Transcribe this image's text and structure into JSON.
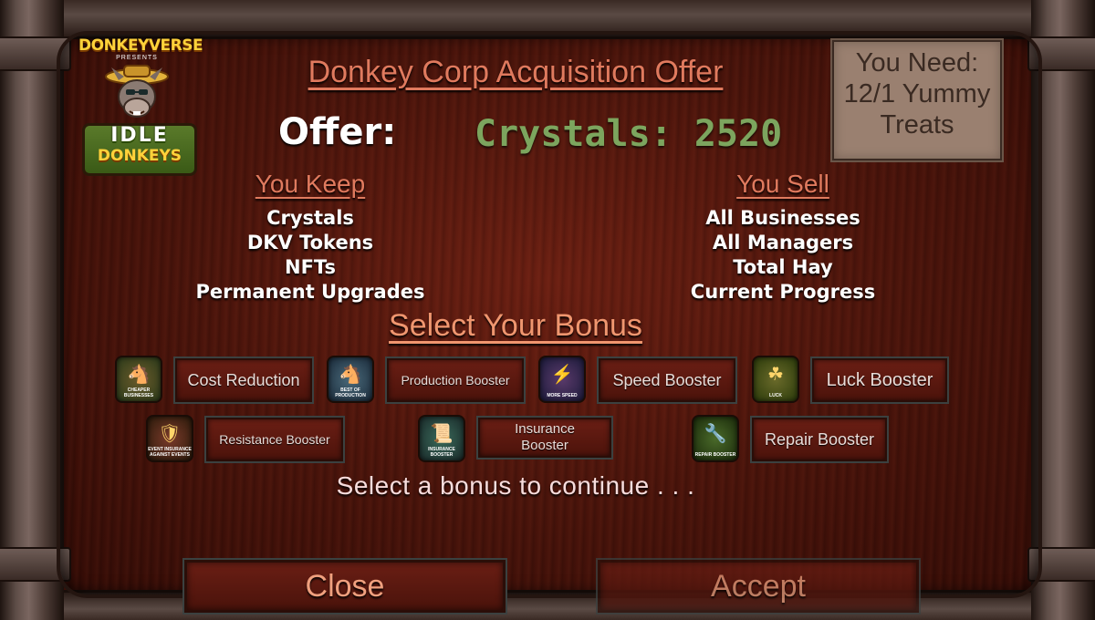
{
  "logo": {
    "top_text": "DONKEYVERSE",
    "presents": "PRESENTS",
    "line1": "IDLE",
    "line2": "DONKEYS"
  },
  "title": "Donkey Corp Acquisition Offer",
  "need": {
    "line1": "You Need:",
    "line2": "12/1 Yummy",
    "line3": "Treats"
  },
  "offer": {
    "label": "Offer:",
    "value": "Crystals: 2520"
  },
  "keep": {
    "heading": "You Keep",
    "items": [
      "Crystals",
      "DKV Tokens",
      "NFTs",
      "Permanent Upgrades"
    ]
  },
  "sell": {
    "heading": "You Sell",
    "items": [
      "All Businesses",
      "All Managers",
      "Total Hay",
      "Current Progress"
    ]
  },
  "bonus_heading": "Select Your Bonus",
  "bonuses": [
    {
      "label": "Cost Reduction",
      "icon": "cheaper-businesses-icon",
      "icon_caption": "CHEAPER BUSINESSES"
    },
    {
      "label": "Production Booster",
      "icon": "best-of-production-icon",
      "icon_caption": "BEST OF PRODUCTION"
    },
    {
      "label": "Speed Booster",
      "icon": "more-speed-icon",
      "icon_caption": "MORE SPEED"
    },
    {
      "label": "Luck Booster",
      "icon": "luck-icon",
      "icon_caption": "LUCK"
    },
    {
      "label": "Resistance Booster",
      "icon": "insurance-events-icon",
      "icon_caption": "EVENT INSURANCE AGAINST EVENTS"
    },
    {
      "label": "Insurance Booster",
      "icon": "insurance-booster-icon",
      "icon_caption": "INSURANCE BOOSTER"
    },
    {
      "label": "Repair Booster",
      "icon": "repair-booster-icon",
      "icon_caption": "REPAIR BOOSTER"
    }
  ],
  "status": "Select a bonus to continue . . .",
  "actions": {
    "close": "Close",
    "accept": "Accept"
  },
  "colors": {
    "accent": "#e07a5e",
    "crystals": "#7ca55e",
    "panel": "#4a140b"
  }
}
